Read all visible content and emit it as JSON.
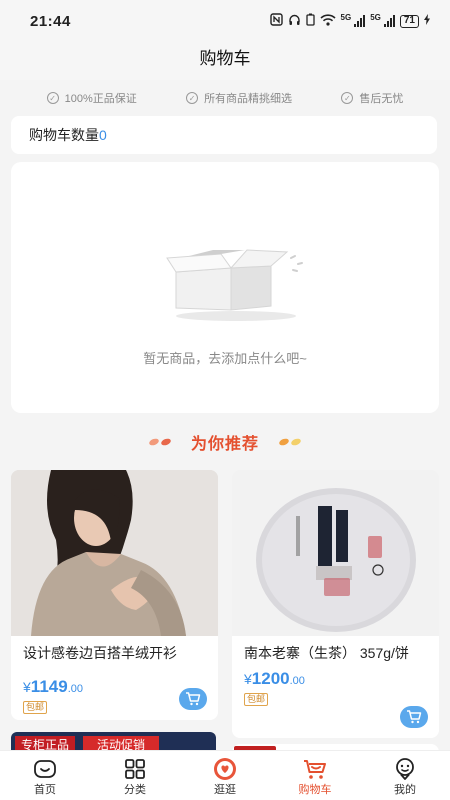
{
  "status_bar": {
    "time": "21:44",
    "network1": "5G",
    "network2": "5G",
    "battery": "71"
  },
  "header": {
    "title": "购物车"
  },
  "guarantees": [
    "100%正品保证",
    "所有商品精挑细选",
    "售后无忧"
  ],
  "cart_count": {
    "label": "购物车数量",
    "value": "0"
  },
  "empty_state": {
    "message": "暂无商品，去添加点什么吧~",
    "icon": "empty-box-icon"
  },
  "recommend": {
    "title": "为你推荐"
  },
  "products": [
    {
      "name": "设计感卷边百搭羊绒开衫",
      "currency": "¥",
      "price_int": "1149",
      "price_dec": ".00",
      "tag": "包邮"
    },
    {
      "name": "南本老寨（生茶） 357g/饼",
      "currency": "¥",
      "price_int": "1200",
      "price_dec": ".00",
      "tag": "包邮"
    }
  ],
  "partial_products": [
    {
      "badge1": "专柜正品",
      "badge2": "活动促销"
    }
  ],
  "tabbar": [
    {
      "label": "首页",
      "icon": "home-icon",
      "active": false
    },
    {
      "label": "分类",
      "icon": "category-icon",
      "active": false
    },
    {
      "label": "逛逛",
      "icon": "browse-icon",
      "active": false
    },
    {
      "label": "购物车",
      "icon": "cart-icon",
      "active": true
    },
    {
      "label": "我的",
      "icon": "profile-icon",
      "active": false
    }
  ],
  "colors": {
    "accent": "#e4502f",
    "price": "#3a8ee6",
    "cart_button": "#5aa8ec"
  }
}
